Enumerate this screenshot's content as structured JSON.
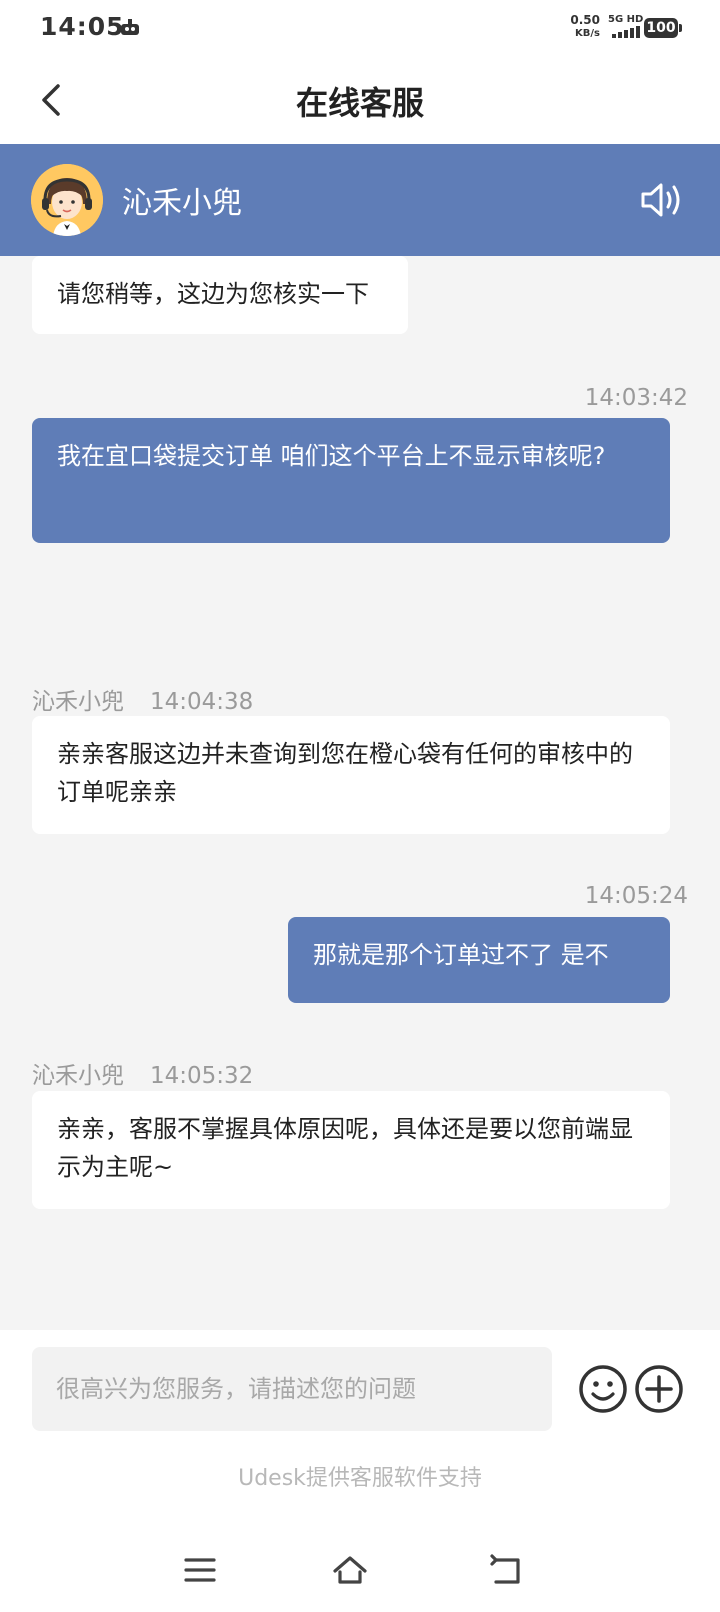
{
  "status_bar": {
    "time": "14:05",
    "speed_value": "0.50",
    "speed_unit": "KB/s",
    "network": "5G HD",
    "battery": "100"
  },
  "header": {
    "title": "在线客服"
  },
  "agent": {
    "name": "沁禾小兜"
  },
  "messages": [
    {
      "side": "left",
      "text": "请您稍等，这边为您核实一下"
    },
    {
      "side": "right",
      "time": "14:03:42",
      "text": "我在宜口袋提交订单 咱们这个平台上不显示审核呢?"
    },
    {
      "side": "left",
      "sender": "沁禾小兜",
      "time": "14:04:38",
      "text": "亲亲客服这边并未查询到您在橙心袋有任何的审核中的订单呢亲亲"
    },
    {
      "side": "right",
      "time": "14:05:24",
      "text": "那就是那个订单过不了 是不"
    },
    {
      "side": "left",
      "sender": "沁禾小兜",
      "time": "14:05:32",
      "text": "亲亲，客服不掌握具体原因呢，具体还是要以您前端显示为主呢~"
    }
  ],
  "composer": {
    "placeholder": "很高兴为您服务，请描述您的问题",
    "powered_by": "Udesk提供客服软件支持"
  },
  "icons": {
    "back": "chevron-left-icon",
    "speaker": "speaker-icon",
    "emoji": "smiley-icon",
    "plus": "plus-circle-icon",
    "menu": "menu-icon",
    "home": "home-icon",
    "return": "return-icon"
  },
  "colors": {
    "accent": "#5f7db7",
    "background": "#f4f4f4"
  }
}
